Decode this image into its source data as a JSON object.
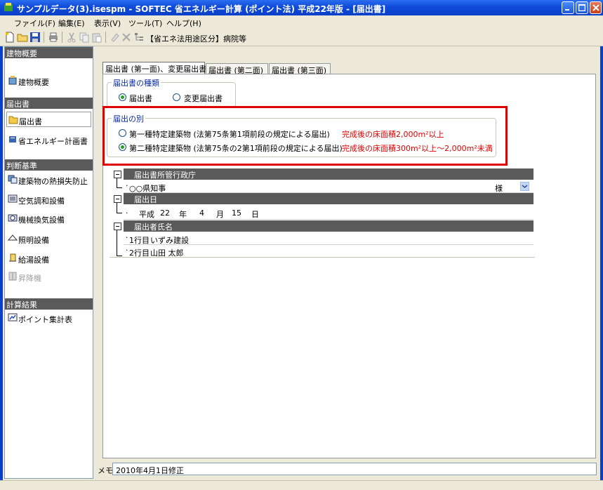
{
  "window": {
    "title": "サンプルデータ(3).isespm - SOFTEC 省エネルギー計算 (ポイント法) 平成22年版 - [届出書]"
  },
  "menu": [
    "ファイル(F)",
    "編集(E)",
    "表示(V)",
    "ツール(T)",
    "ヘルプ(H)"
  ],
  "toolbar": {
    "category_label": "【省エネ法用途区分】病院等"
  },
  "sidebar": {
    "sections": [
      {
        "label": "建物概要",
        "items": [
          {
            "label": "建物概要",
            "icon": "building-icon"
          }
        ]
      },
      {
        "label": "届出書",
        "items": [
          {
            "label": "届出書",
            "icon": "folder-icon",
            "selected": true
          },
          {
            "label": "省エネルギー計画書",
            "icon": "document-icon"
          }
        ]
      },
      {
        "label": "判断基準",
        "items": [
          {
            "label": "建築物の熱損失防止",
            "icon": "insulation-icon"
          },
          {
            "label": "空気調和設備",
            "icon": "aircon-icon"
          },
          {
            "label": "機械換気設備",
            "icon": "ventilation-icon"
          },
          {
            "label": "照明設備",
            "icon": "lighting-icon"
          },
          {
            "label": "給湯設備",
            "icon": "water-heater-icon"
          },
          {
            "label": "昇降機",
            "icon": "elevator-icon",
            "disabled": true
          }
        ]
      },
      {
        "label": "計算結果",
        "items": [
          {
            "label": "ポイント集計表",
            "icon": "summary-icon"
          }
        ]
      }
    ]
  },
  "tabs": [
    "届出書 (第一面)、変更届出書",
    "届出書 (第二面)",
    "届出書 (第三面)"
  ],
  "form": {
    "type_group": {
      "legend": "届出書の種類",
      "options": [
        "届出書",
        "変更届出書"
      ],
      "selected": 0
    },
    "class_group": {
      "legend": "届出の別",
      "options": [
        {
          "label": "第一種特定建築物 (法第75条第1項前段の規定による届出)",
          "note": "完成後の床面積2,000m²以上"
        },
        {
          "label": "第二種特定建築物 (法第75条の2第1項前段の規定による届出)",
          "note": "完成後の床面積300m²以上～2,000m²未満"
        }
      ],
      "selected": 1
    }
  },
  "grid": {
    "authority": {
      "header": "届出書所管行政庁",
      "value": "○○県知事",
      "suffix": "様"
    },
    "date": {
      "header": "届出日",
      "era": "平成",
      "year": "22",
      "year_unit": "年",
      "month": "4",
      "month_unit": "月",
      "day": "15",
      "day_unit": "日"
    },
    "applicant": {
      "header": "届出者氏名",
      "line1_label": "1行目",
      "line1": "いずみ建設",
      "line2_label": "2行目",
      "line2": "山田 太郎"
    }
  },
  "memo": {
    "label": "メモ",
    "value": "2010年4月1日修正"
  },
  "colors": {
    "accent_red": "#e00000",
    "legend_blue": "#0b2ca8",
    "header_gray": "#5a5a5a"
  }
}
